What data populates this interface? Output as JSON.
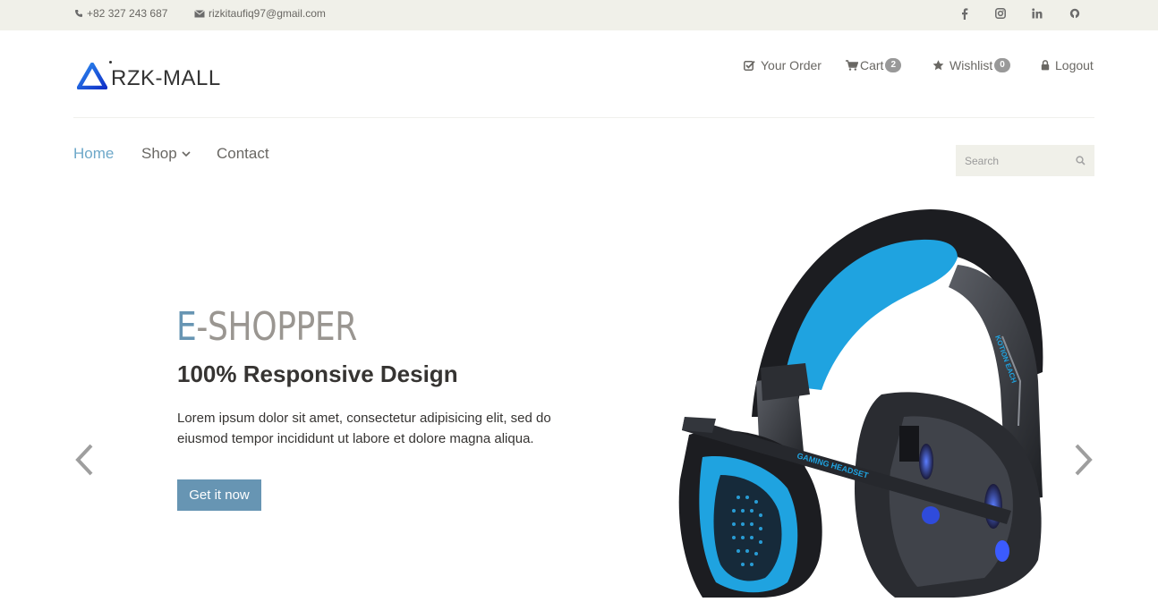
{
  "topbar": {
    "phone": "+82 327 243 687",
    "email": "rizkitaufiq97@gmail.com",
    "social": [
      {
        "name": "facebook-icon",
        "glyph": "f"
      },
      {
        "name": "instagram-icon",
        "glyph": ""
      },
      {
        "name": "linkedin-icon",
        "glyph": "in"
      },
      {
        "name": "github-icon",
        "glyph": ""
      }
    ]
  },
  "brand": {
    "name": "RZK-MALL",
    "color": "#1a5fd6"
  },
  "shop_menu": {
    "order_label": "Your Order",
    "cart_label": "Cart",
    "cart_count": "2",
    "wishlist_label": "Wishlist",
    "wishlist_count": "0",
    "logout_label": "Logout"
  },
  "nav": {
    "home": "Home",
    "shop": "Shop",
    "contact": "Contact",
    "search_placeholder": "Search",
    "active_color": "#6ea8c9"
  },
  "hero": {
    "title_first": "E",
    "title_rest": "-SHOPPER",
    "subtitle": "100% Responsive Design",
    "text_line1": "Lorem ipsum dolor sit amet, consectetur adipisicing elit, sed do",
    "text_line2": "eiusmod tempor incididunt ut labore et dolore magna aliqua.",
    "button_label": "Get it now",
    "accent_color": "#6795b3",
    "product_print": "GAMING HEADSET",
    "product_brand_print": "KOTION EACH"
  }
}
